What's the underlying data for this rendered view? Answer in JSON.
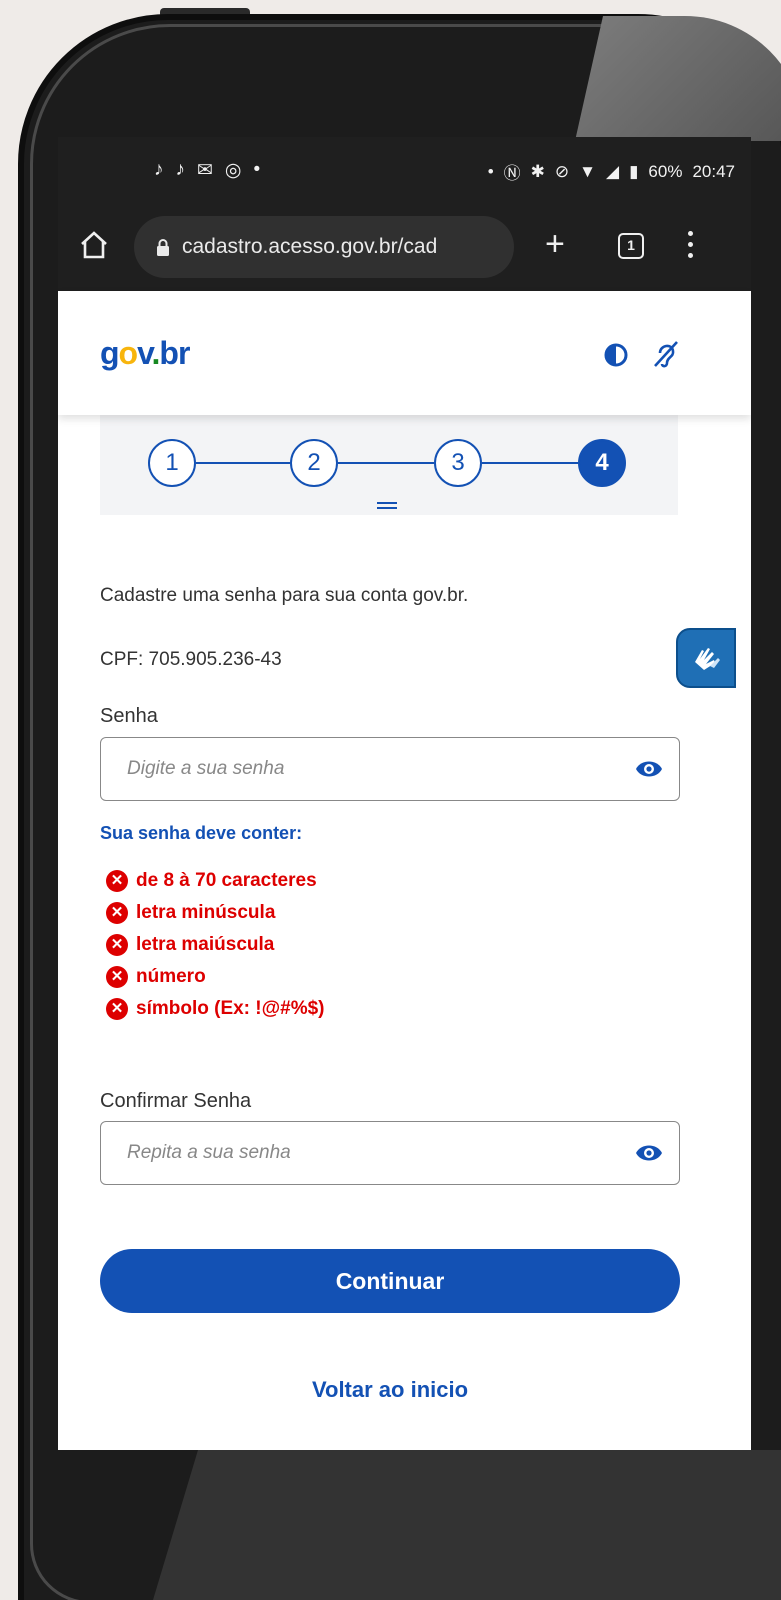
{
  "status_bar": {
    "notification_icons": [
      "tiktok-icon",
      "tiktok-icon",
      "gmail-icon",
      "instagram-icon",
      "•"
    ],
    "indicators": [
      "•",
      "nfc-icon",
      "bluetooth-icon",
      "mute-icon",
      "wifi-icon",
      "signal-icon",
      "battery-icon"
    ],
    "battery": "60%",
    "time": "20:47"
  },
  "browser": {
    "url": "cadastro.acesso.gov.br/cad",
    "tab_count": "1"
  },
  "header": {
    "logo": "gov.br"
  },
  "stepper": {
    "steps": [
      "1",
      "2",
      "3",
      "4"
    ],
    "current_step": 4
  },
  "content": {
    "intro": "Cadastre uma senha para sua conta gov.br.",
    "cpf": "CPF: 705.905.236-43",
    "password_label": "Senha",
    "password_placeholder": "Digite a sua senha",
    "rules_title": "Sua senha deve conter:",
    "rules": [
      "de 8 à 70 caracteres",
      "letra minúscula",
      "letra maiúscula",
      "número",
      "símbolo (Ex: !@#%$)"
    ],
    "confirm_label": "Confirmar Senha",
    "confirm_placeholder": "Repita a sua senha",
    "continue_label": "Continuar",
    "back_label": "Voltar ao inicio"
  },
  "colors": {
    "primary": "#1351b4",
    "error": "#d00000",
    "logo_yellow": "#f8b50d",
    "logo_green": "#168821"
  }
}
